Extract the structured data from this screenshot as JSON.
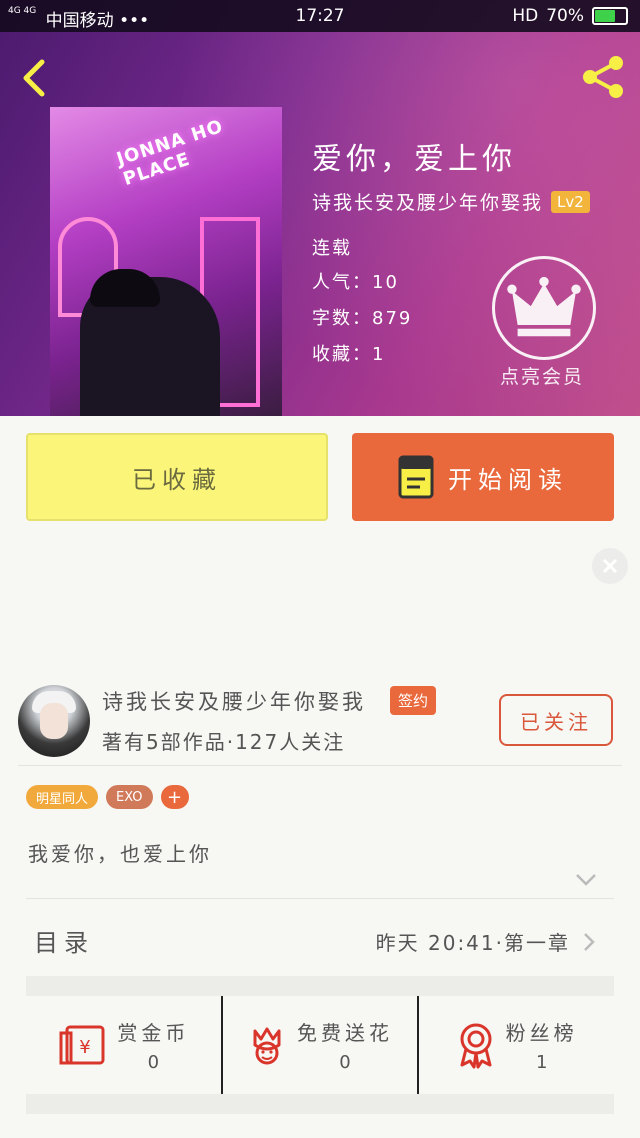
{
  "status_bar": {
    "network": "4G 4G",
    "carrier": "中国移动 •••",
    "time": "17:27",
    "hd": "HD",
    "battery": "70%",
    "battery_level": 0.7
  },
  "book": {
    "title": "爱你，爱上你",
    "author": "诗我长安及腰少年你娶我",
    "level": "Lv2",
    "status": "连载",
    "popularity": "人气：10",
    "word_count": "字数：879",
    "favorites": "收藏：1",
    "cover_sign": "JONNA HO PLACE"
  },
  "vip": {
    "label": "点亮会员"
  },
  "buttons": {
    "collected": "已收藏",
    "start_reading": "开始阅读"
  },
  "author_panel": {
    "name": "诗我长安及腰少年你娶我",
    "signed_badge": "签约",
    "stats": "著有5部作品·127人关注",
    "follow": "已关注"
  },
  "tags": [
    "明星同人",
    "EXO",
    "+"
  ],
  "summary": "我爱你，也爱上你",
  "toc": {
    "label": "目录",
    "latest": "昨天 20:41·第一章"
  },
  "actions": [
    {
      "icon": "red-envelope-icon",
      "label": "赏金币",
      "value": "0"
    },
    {
      "icon": "flower-icon",
      "label": "免费送花",
      "value": "0"
    },
    {
      "icon": "ribbon-medal-icon",
      "label": "粉丝榜",
      "value": "1"
    }
  ],
  "colors": {
    "accent_orange": "#e9683c",
    "yellow_button": "#fbf67a",
    "icon_red": "#d9352b",
    "lv_gold": "#f3b43b"
  }
}
